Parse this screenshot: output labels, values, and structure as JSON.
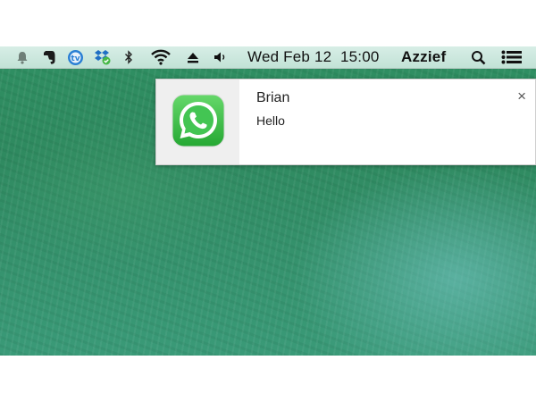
{
  "menubar": {
    "icons": [
      "notifications-bell-icon",
      "evernote-icon",
      "teamviewer-icon",
      "dropbox-icon",
      "bluetooth-icon",
      "wifi-icon",
      "eject-icon",
      "volume-icon",
      "spotlight-search-icon",
      "notification-center-icon"
    ],
    "date": "Wed Feb 12",
    "time": "15:00",
    "user": "Azzief"
  },
  "notification": {
    "app_icon": "whatsapp-icon",
    "title": "Brian",
    "message": "Hello",
    "close_label": "×"
  },
  "colors": {
    "menubar_bg": "#cde8de",
    "desktop": "#2f8f62",
    "whatsapp_green": "#43c553",
    "notification_bg": "#ffffff"
  }
}
